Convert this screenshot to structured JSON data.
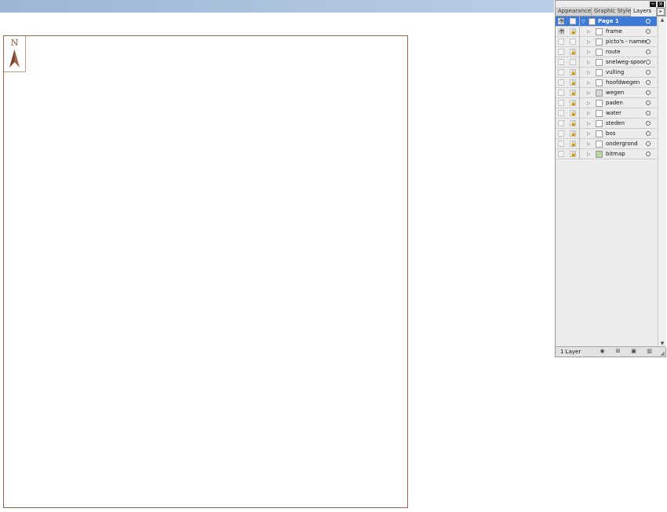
{
  "artboard": {
    "north_label": "N"
  },
  "panel": {
    "controls": {
      "minimize": "−",
      "close": "×"
    },
    "tabs": [
      {
        "label": "Appearance",
        "active": false
      },
      {
        "label": "Graphic Styles",
        "active": false
      },
      {
        "label": "Layers",
        "active": true
      }
    ],
    "tab_menu": "▸",
    "top_layer": {
      "name": "Page 1",
      "visible_icon": "👁",
      "expand": "▽"
    },
    "sublayers": [
      {
        "name": "frame",
        "visible": true,
        "locked": true,
        "thumb": "plain"
      },
      {
        "name": "picto's - namen",
        "visible": false,
        "locked": false,
        "thumb": "plain"
      },
      {
        "name": "route",
        "visible": false,
        "locked": true,
        "thumb": "plain"
      },
      {
        "name": "snelweg-spoor",
        "visible": false,
        "locked": false,
        "thumb": "plain"
      },
      {
        "name": "vulling",
        "visible": false,
        "locked": true,
        "thumb": "plain"
      },
      {
        "name": "hoofdwegen",
        "visible": false,
        "locked": true,
        "thumb": "plain"
      },
      {
        "name": "wegen",
        "visible": false,
        "locked": true,
        "thumb": "gray"
      },
      {
        "name": "paden",
        "visible": false,
        "locked": true,
        "thumb": "plain"
      },
      {
        "name": "water",
        "visible": false,
        "locked": true,
        "thumb": "plain"
      },
      {
        "name": "steden",
        "visible": false,
        "locked": true,
        "thumb": "plain"
      },
      {
        "name": "bos",
        "visible": false,
        "locked": true,
        "thumb": "plain"
      },
      {
        "name": "ondergrond",
        "visible": false,
        "locked": true,
        "thumb": "plain"
      },
      {
        "name": "bitmap",
        "visible": false,
        "locked": true,
        "thumb": "green"
      }
    ],
    "glyphs": {
      "eye": "👁",
      "lock": "🔒",
      "expand": "▷"
    },
    "footer": {
      "label": "1 Layer",
      "icons": [
        "make-clipping-mask-icon",
        "new-sublayer-icon",
        "new-layer-icon",
        "delete-layer-icon"
      ]
    },
    "colors": {
      "selection": "#3c79d9",
      "artboard_border": "#a0644a"
    }
  }
}
